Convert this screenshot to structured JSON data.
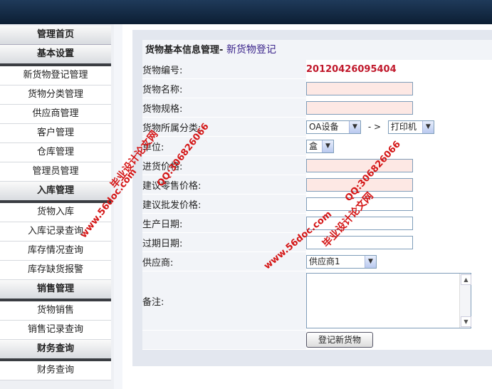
{
  "sidebar": {
    "top": {
      "label": "管理首页"
    },
    "sections": [
      {
        "title": "基本设置",
        "items": [
          "新货物登记管理",
          "货物分类管理",
          "供应商管理",
          "客户管理",
          "仓库管理",
          "管理员管理"
        ]
      },
      {
        "title": "入库管理",
        "items": [
          "货物入库",
          "入库记录查询",
          "库存情况查询",
          "库存缺货报警"
        ]
      },
      {
        "title": "销售管理",
        "items": [
          "货物销售",
          "销售记录查询"
        ]
      },
      {
        "title": "财务查询",
        "items": [
          "财务查询"
        ]
      }
    ]
  },
  "panel": {
    "title": "货物基本信息管理",
    "separator": "- ",
    "subtitle": "新货物登记"
  },
  "form": {
    "code_label": "货物编号:",
    "code_value": "20120426095404",
    "name_label": "货物名称:",
    "spec_label": "货物规格:",
    "category_label": "货物所属分类:",
    "category_select": "OA设备",
    "category_arrow": "- >",
    "category_sub_select": "打印机",
    "unit_label": "单位:",
    "unit_select": "盒",
    "purchase_label": "进货价格:",
    "retail_label": "建议零售价格:",
    "wholesale_label": "建议批发价格:",
    "mfg_date_label": "生产日期:",
    "exp_date_label": "过期日期:",
    "supplier_label": "供应商:",
    "supplier_select": "供应商1",
    "remark_label": "备注:",
    "submit_label": "登记新货物"
  },
  "watermarks": {
    "left_title": "毕业设计论文网",
    "left_url": "www.56doc.com",
    "left_qq": "QQ:306826066",
    "right_title": "毕业设计论文网",
    "right_url": "www.56doc.com",
    "right_qq": "QQ:306826066"
  },
  "colors": {
    "code": "#c0182b",
    "subtitle": "#3a238a",
    "watermark": "#d41616",
    "topbar": "#12263e"
  }
}
